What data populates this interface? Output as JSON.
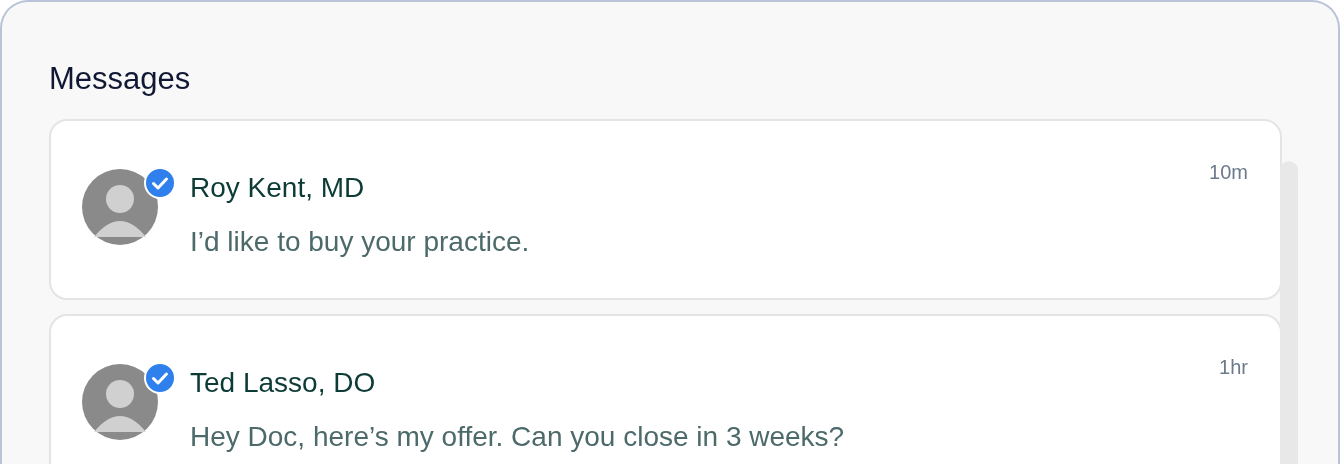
{
  "title": "Messages",
  "messages": [
    {
      "sender": "Roy Kent, MD",
      "verified": true,
      "text": "I’d like to buy your practice.",
      "time": "10m"
    },
    {
      "sender": "Ted Lasso, DO",
      "verified": true,
      "text": "Hey Doc, here’s my offer. Can you close in 3 weeks?",
      "time": "1hr"
    }
  ]
}
